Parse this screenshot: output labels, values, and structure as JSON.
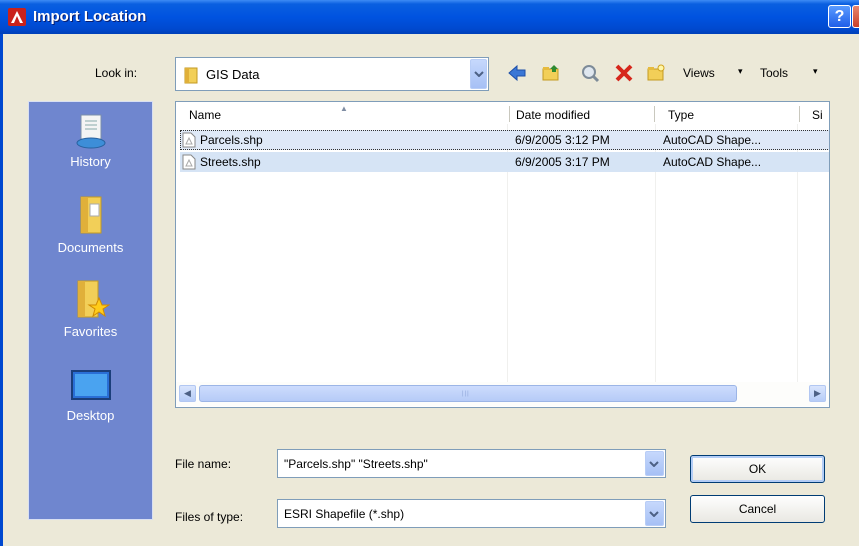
{
  "window": {
    "title": "Import Location",
    "help_label": "?",
    "close_label": "X"
  },
  "toolbar": {
    "look_in_label": "Look in:",
    "look_in_value": "GIS Data",
    "views_label": "Views",
    "tools_label": "Tools",
    "icons": [
      "back-icon",
      "up-folder-icon",
      "search-web-icon",
      "delete-icon",
      "new-folder-icon"
    ]
  },
  "places": [
    {
      "label": "History",
      "icon": "history-icon"
    },
    {
      "label": "Documents",
      "icon": "documents-icon"
    },
    {
      "label": "Favorites",
      "icon": "favorites-icon"
    },
    {
      "label": "Desktop",
      "icon": "desktop-icon"
    }
  ],
  "file_list": {
    "columns": [
      "Name",
      "Date modified",
      "Type",
      "Si"
    ],
    "rows": [
      {
        "name": "Parcels.shp",
        "date": "6/9/2005 3:12 PM",
        "type": "AutoCAD Shape..."
      },
      {
        "name": "Streets.shp",
        "date": "6/9/2005 3:17 PM",
        "type": "AutoCAD Shape..."
      }
    ]
  },
  "form": {
    "file_name_label": "File name:",
    "file_name_value": "\"Parcels.shp\" \"Streets.shp\"",
    "file_type_label": "Files of type:",
    "file_type_value": "ESRI Shapefile  (*.shp)"
  },
  "buttons": {
    "ok": "OK",
    "cancel": "Cancel"
  },
  "colors": {
    "titlebar": "#0053e0",
    "places_panel": "#6f86cf",
    "dialog_bg": "#ece9d8",
    "selection": "#dfe9f7"
  }
}
